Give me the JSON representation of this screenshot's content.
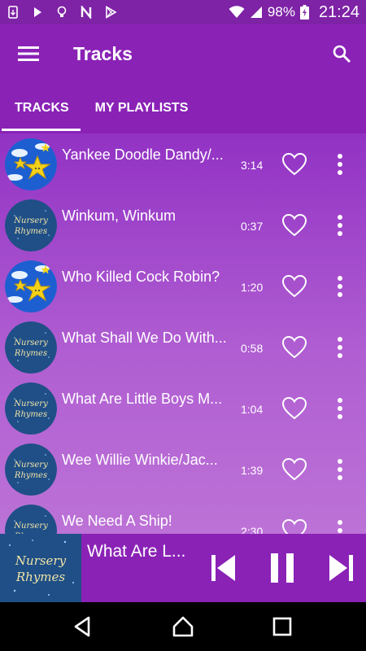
{
  "status_bar": {
    "battery": "98%",
    "time": "21:24"
  },
  "app_bar": {
    "title": "Tracks"
  },
  "tabs": [
    {
      "label": "TRACKS",
      "selected": true
    },
    {
      "label": "MY PLAYLISTS",
      "selected": false
    }
  ],
  "tracks": [
    {
      "title": "Yankee Doodle Dandy/...",
      "duration": "3:14",
      "art": "stars"
    },
    {
      "title": "Winkum, Winkum",
      "duration": "0:37",
      "art": "nursery-rhymes"
    },
    {
      "title": "Who Killed Cock Robin?",
      "duration": "1:20",
      "art": "stars"
    },
    {
      "title": "What Shall We Do With...",
      "duration": "0:58",
      "art": "nursery-rhymes"
    },
    {
      "title": "What Are Little Boys M...",
      "duration": "1:04",
      "art": "nursery-rhymes"
    },
    {
      "title": "Wee Willie Winkie/Jac...",
      "duration": "1:39",
      "art": "nursery-rhymes"
    },
    {
      "title": "We Need A Ship!",
      "duration": "2:30",
      "art": "nursery-rhymes"
    }
  ],
  "art_text": {
    "line1": "Nursery",
    "line2": "Rhymes"
  },
  "now_playing": {
    "title": "What Are L..."
  },
  "colors": {
    "primary": "#8a22b6",
    "status_bar": "#7e22a6",
    "list_gradient_top": "#9232c4",
    "list_gradient_bottom": "#bc72d6",
    "art_navy": "#1f4f86",
    "art_sky": "#1d5fd1",
    "star_yellow": "#f5d21a"
  },
  "icons": {
    "menu": "hamburger-menu-icon",
    "search": "search-icon",
    "heart": "heart-outline-icon",
    "more": "more-vertical-icon",
    "prev": "skip-previous-icon",
    "pause": "pause-icon",
    "next": "skip-next-icon",
    "nav_back": "back-triangle-icon",
    "nav_home": "home-icon",
    "nav_recents": "recents-square-icon"
  }
}
